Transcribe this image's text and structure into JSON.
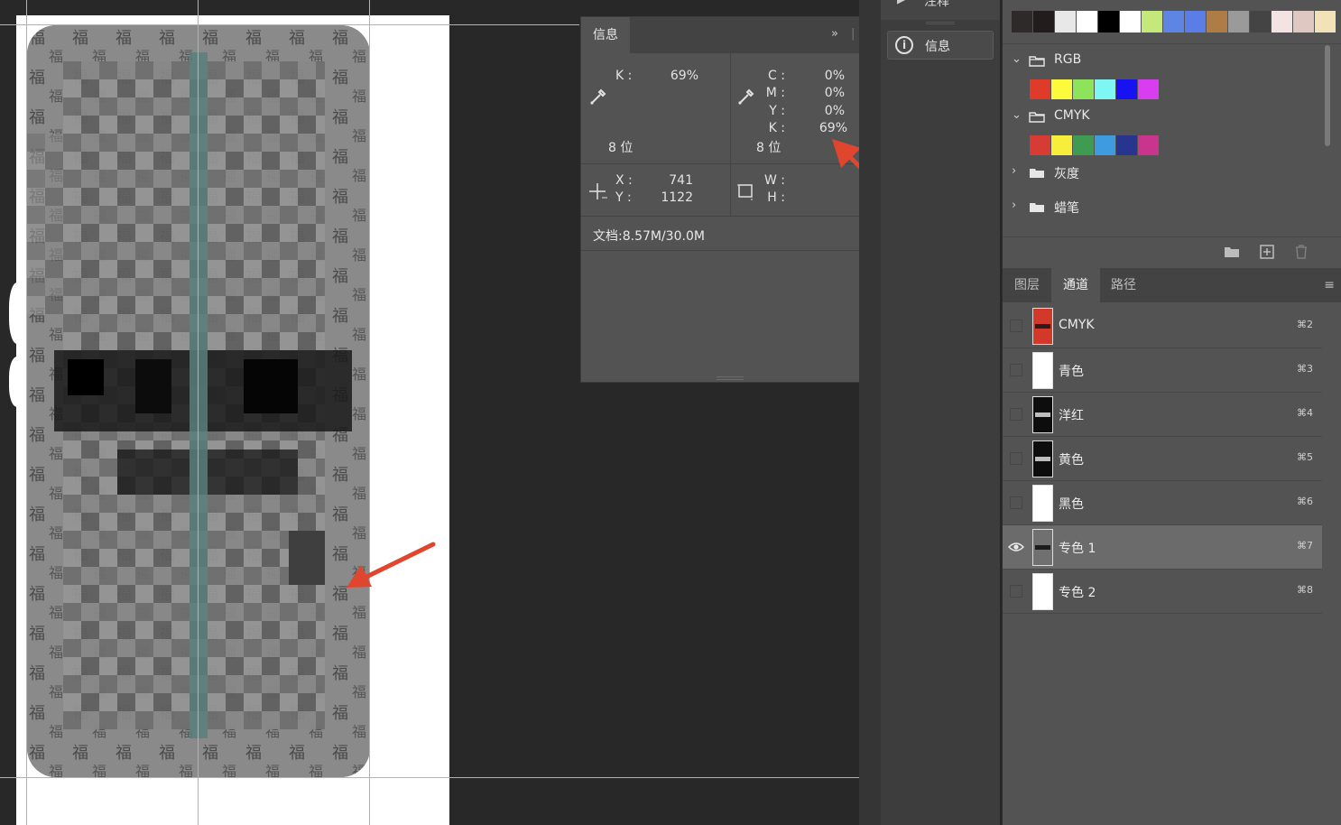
{
  "info_panel": {
    "tab": "信息",
    "more_icon": "double-chevron-icon",
    "menu_icon": "hamburger-icon",
    "left_readout": {
      "k_label": "K :",
      "k_value": "69%",
      "bits": "8 位"
    },
    "right_readout": {
      "c_label": "C :",
      "c_value": "0%",
      "m_label": "M :",
      "m_value": "0%",
      "y_label": "Y :",
      "y_value": "0%",
      "k_label": "K :",
      "k_value": "69%",
      "bits": "8 位"
    },
    "position": {
      "x_label": "X :",
      "x_value": "741",
      "y_label": "Y :",
      "y_value": "1122"
    },
    "size": {
      "w_label": "W :",
      "h_label": "H :"
    },
    "document": "文档:8.57M/30.0M"
  },
  "dock": {
    "top_item": "注释",
    "info_button": "信息",
    "info_icon": "info-circle-icon"
  },
  "swatches": {
    "top_strip": [
      "#2e2a2a",
      "#231c1c",
      "#e8e8e8",
      "#ffffff",
      "#000000",
      "#ffffff",
      "#c5e87a",
      "#5d85e3",
      "#5a7ee6",
      "#b07c45",
      "#9a9a9a",
      "#444444",
      "#f3e4e3",
      "#e0c8c2",
      "#f2e2b8"
    ],
    "groups": [
      {
        "name": "RGB",
        "expanded": true,
        "colors": [
          "#e03a2a",
          "#fbfb3c",
          "#8ee35c",
          "#7ef6f4",
          "#1612f2",
          "#d83ef0"
        ]
      },
      {
        "name": "CMYK",
        "expanded": true,
        "colors": [
          "#d63c33",
          "#f7ed3b",
          "#3f9a52",
          "#3f9be0",
          "#27358f",
          "#c9358c"
        ]
      },
      {
        "name": "灰度",
        "expanded": false
      },
      {
        "name": "蜡笔",
        "expanded": false
      }
    ],
    "bottom_icons": [
      "new-group-icon",
      "new-swatch-icon",
      "trash-icon"
    ]
  },
  "channels_panel": {
    "tabs": [
      "图层",
      "通道",
      "路径"
    ],
    "active_tab": "通道",
    "channels": [
      {
        "name": "CMYK",
        "shortcut": "⌘2",
        "visible": false,
        "selected": false,
        "thumb": "color"
      },
      {
        "name": "青色",
        "shortcut": "⌘3",
        "visible": false,
        "selected": false,
        "thumb": "white"
      },
      {
        "name": "洋红",
        "shortcut": "⌘4",
        "visible": false,
        "selected": false,
        "thumb": "black"
      },
      {
        "name": "黄色",
        "shortcut": "⌘5",
        "visible": false,
        "selected": false,
        "thumb": "black"
      },
      {
        "name": "黑色",
        "shortcut": "⌘6",
        "visible": false,
        "selected": false,
        "thumb": "white"
      },
      {
        "name": "专色 1",
        "shortcut": "⌘7",
        "visible": true,
        "selected": true,
        "thumb": "gray"
      },
      {
        "name": "专色 2",
        "shortcut": "⌘8",
        "visible": false,
        "selected": false,
        "thumb": "white"
      }
    ]
  },
  "canvas": {
    "guide_color": "#52d8e6",
    "annotation_color": "#e0452e"
  }
}
